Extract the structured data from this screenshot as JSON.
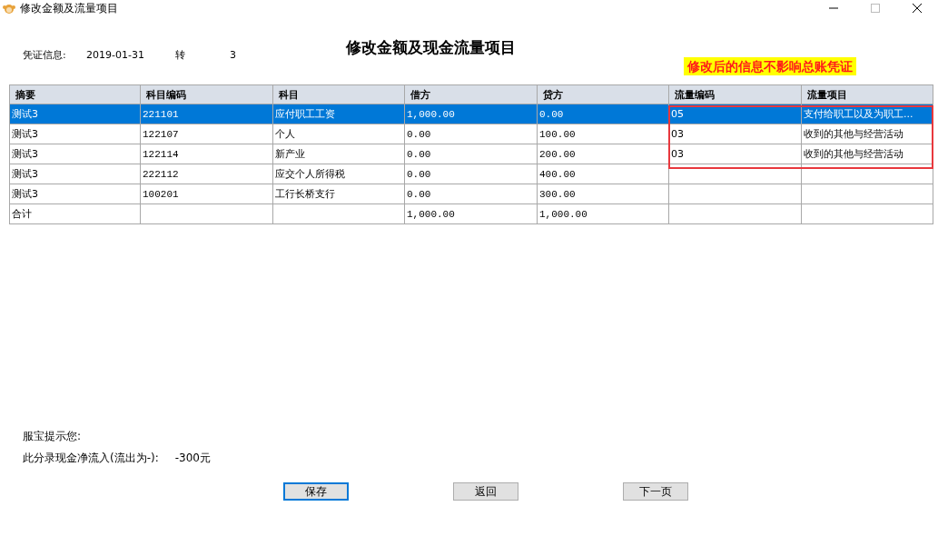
{
  "window": {
    "title": "修改金额及流量项目"
  },
  "heading": "修改金额及现金流量项目",
  "voucher": {
    "label": "凭证信息:",
    "date": "2019-01-31",
    "type": "转",
    "number": "3"
  },
  "annotation": {
    "text": "修改后的信息不影响总账凭证"
  },
  "table": {
    "columns": [
      "摘要",
      "科目编码",
      "科目",
      "借方",
      "贷方",
      "流量编码",
      "流量项目"
    ],
    "rows": [
      {
        "cells": [
          "测试3",
          "221101",
          "应付职工工资",
          "1,000.00",
          "0.00",
          "05",
          "支付给职工以及为职工..."
        ],
        "selected": true,
        "highlighted": true
      },
      {
        "cells": [
          "测试3",
          "122107",
          "个人",
          "0.00",
          "100.00",
          "03",
          "收到的其他与经营活动"
        ],
        "selected": false,
        "highlighted": true
      },
      {
        "cells": [
          "测试3",
          "122114",
          "新产业",
          "0.00",
          "200.00",
          "03",
          "收到的其他与经营活动"
        ],
        "selected": false,
        "highlighted": true
      },
      {
        "cells": [
          "测试3",
          "222112",
          "应交个人所得税",
          "0.00",
          "400.00",
          "",
          ""
        ],
        "selected": false,
        "highlighted": false
      },
      {
        "cells": [
          "测试3",
          "100201",
          "工行长桥支行",
          "0.00",
          "300.00",
          "",
          ""
        ],
        "selected": false,
        "highlighted": false
      },
      {
        "cells": [
          "合计",
          "",
          "",
          "1,000.00",
          "1,000.00",
          "",
          ""
        ],
        "selected": false,
        "highlighted": false
      }
    ]
  },
  "tips": {
    "title": "服宝提示您:",
    "label": "此分录现金净流入(流出为-):",
    "value": "-300元"
  },
  "buttons": [
    {
      "label": "保存",
      "focused": true
    },
    {
      "label": "返回",
      "focused": false
    },
    {
      "label": "下一页",
      "focused": false
    }
  ]
}
